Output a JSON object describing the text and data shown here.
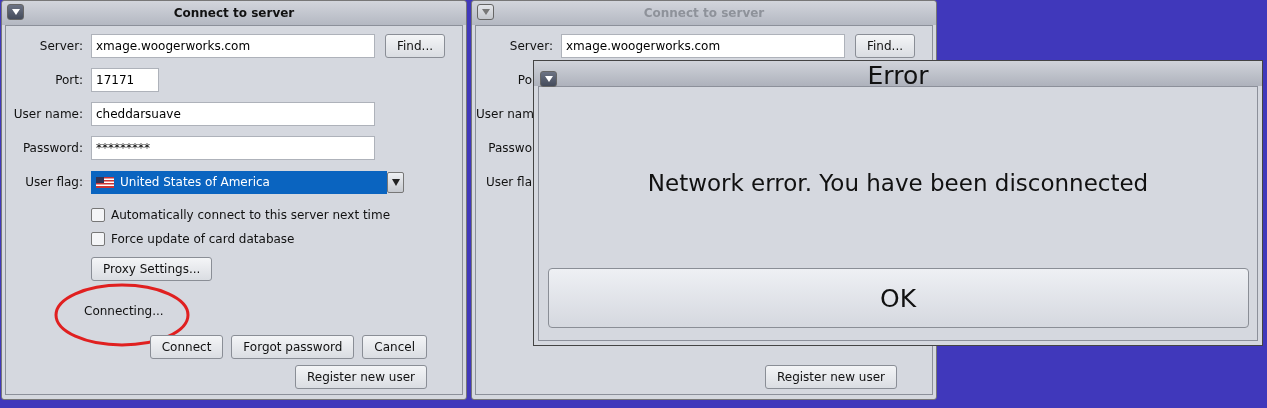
{
  "windows": [
    {
      "title": "Connect to server",
      "active": true,
      "rows": [
        {
          "kind": "text",
          "label": "Server:",
          "value": "xmage.woogerworks.com",
          "button": "Find..."
        },
        {
          "kind": "short",
          "label": "Port:",
          "value": "17171"
        },
        {
          "kind": "text",
          "label": "User name:",
          "value": "cheddarsuave"
        },
        {
          "kind": "text",
          "label": "Password:",
          "value": "*********"
        },
        {
          "kind": "flag",
          "label": "User flag:",
          "value": "United States of America"
        }
      ],
      "options": [
        {
          "label": "Automatically connect to this server next time",
          "checked": false
        },
        {
          "label": "Force update of card database",
          "checked": false
        }
      ],
      "proxy_button": "Proxy Settings...",
      "status": "Connecting...",
      "actions": [
        {
          "label": "Connect",
          "disabled": false
        },
        {
          "label": "Forgot password",
          "disabled": false
        },
        {
          "label": "Cancel",
          "disabled": false
        }
      ],
      "register_button": "Register new user"
    },
    {
      "title": "Connect to server",
      "active": false,
      "rows": [
        {
          "kind": "text",
          "label": "Server:",
          "value": "xmage.woogerworks.com",
          "button": "Find..."
        },
        {
          "kind": "cut",
          "label": "Po"
        },
        {
          "kind": "cut",
          "label": "User nam"
        },
        {
          "kind": "cut",
          "label": "Passwo"
        },
        {
          "kind": "cut",
          "label": "User fla"
        }
      ],
      "register_button": "Register new user"
    }
  ],
  "error_dialog": {
    "title": "Error",
    "message": "Network error. You have been disconnected",
    "button": "OK"
  }
}
